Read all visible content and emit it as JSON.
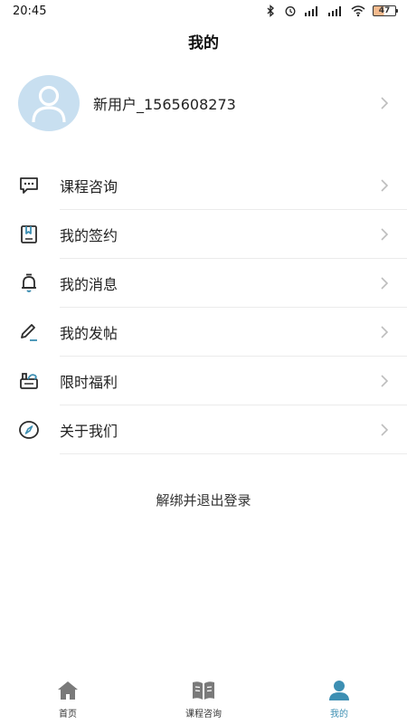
{
  "status_bar": {
    "time": "20:45",
    "battery": "47"
  },
  "header": {
    "title": "我的"
  },
  "profile": {
    "name": "新用户_1565608273"
  },
  "menu": [
    {
      "label": "课程咨询",
      "icon": "chat-icon"
    },
    {
      "label": "我的签约",
      "icon": "bookmark-book-icon"
    },
    {
      "label": "我的消息",
      "icon": "bell-icon"
    },
    {
      "label": "我的发帖",
      "icon": "pen-icon"
    },
    {
      "label": "限时福利",
      "icon": "gift-icon"
    },
    {
      "label": "关于我们",
      "icon": "compass-icon"
    }
  ],
  "logout_label": "解绑并退出登录",
  "bottom_nav": [
    {
      "label": "首页",
      "icon": "home-icon",
      "active": false
    },
    {
      "label": "课程咨询",
      "icon": "book-icon",
      "active": false
    },
    {
      "label": "我的",
      "icon": "user-icon",
      "active": true
    }
  ],
  "colors": {
    "accent": "#3d8fb3",
    "avatar_bg": "#c8dff0",
    "nav_inactive": "#7a7a7a"
  }
}
